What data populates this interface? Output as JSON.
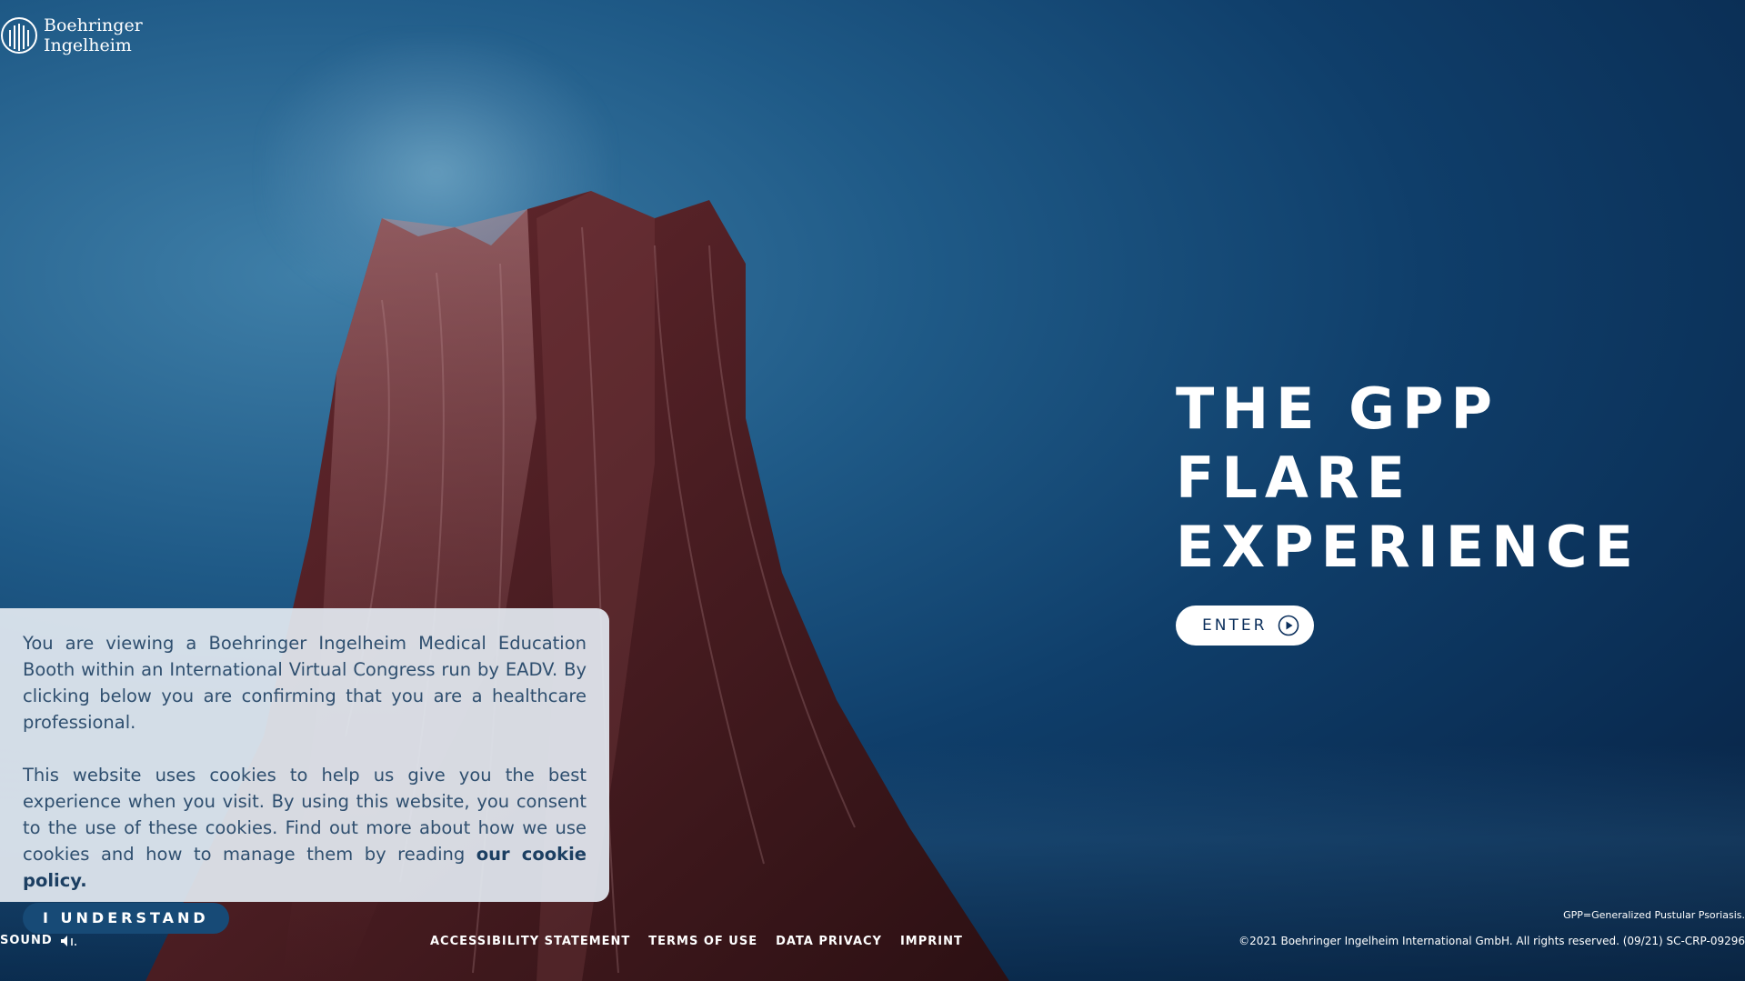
{
  "brand": {
    "line1": "Boehringer",
    "line2": "Ingelheim",
    "icon": "boehringer-logo-icon"
  },
  "hero": {
    "title_lines": [
      "THE GPP",
      "FLARE",
      "EXPERIENCE"
    ],
    "enter_label": "ENTER",
    "enter_icon": "play-circle-icon"
  },
  "cookie": {
    "paragraph1": "You are viewing a Boehringer Ingelheim Medical Education Booth within an International Virtual Congress run by EADV. By clicking below you are confirming that you are a healthcare professional.",
    "paragraph2_prefix": "This website uses cookies to help us give you the best experience when you visit. By using this website, you consent to the use of these cookies. Find out more about how we use cookies and how to manage them by reading ",
    "policy_link": "our cookie policy.",
    "button_label": "I UNDERSTAND"
  },
  "footer": {
    "sound_label": "SOUND",
    "sound_icon": "speaker-icon",
    "links": [
      "ACCESSIBILITY STATEMENT",
      "TERMS OF USE",
      "DATA PRIVACY",
      "IMPRINT"
    ],
    "gpp_note": "GPP=Generalized Pustular Psoriasis.",
    "copyright": "©2021 Boehringer Ingelheim International GmbH.   All rights reserved. (09/21) SC-CRP-09296"
  },
  "colors": {
    "background_dark": "#0a2c52",
    "background_light": "#3f7fa8",
    "button_blue": "#174a76",
    "cookie_panel": "#e2e8f0"
  }
}
